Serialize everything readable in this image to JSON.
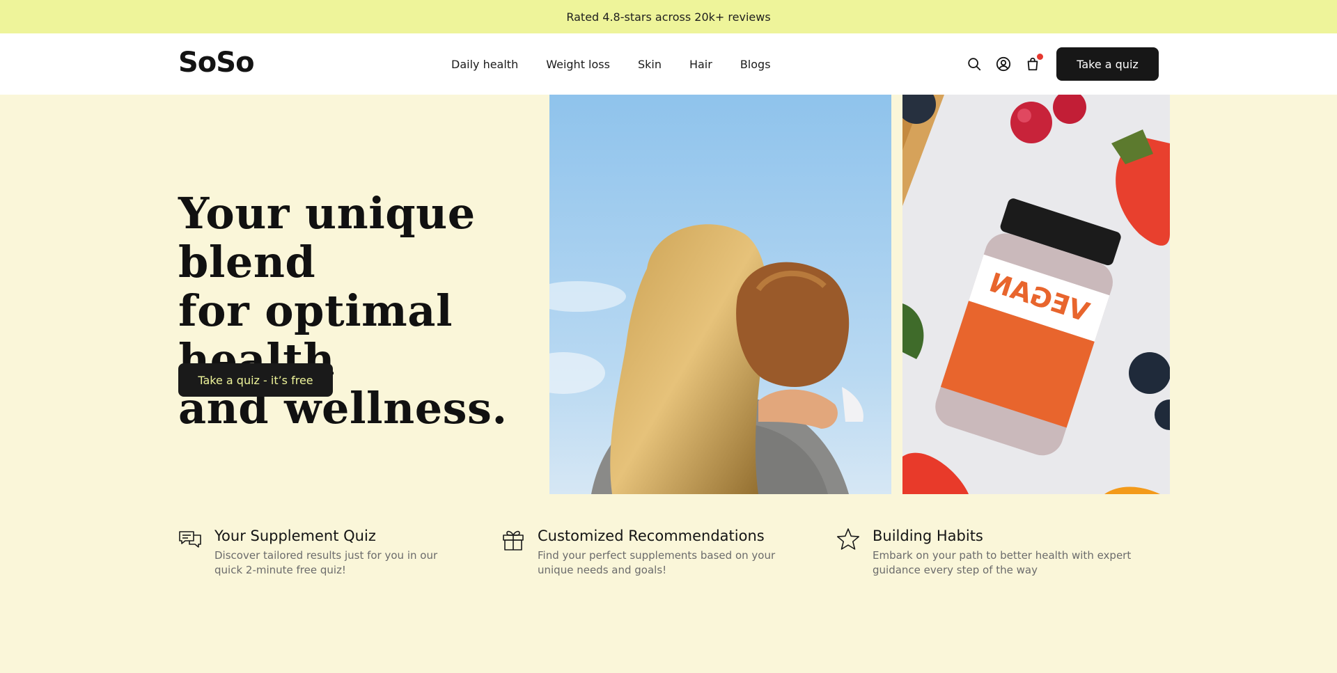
{
  "announcement": "Rated 4.8-stars across 20k+ reviews",
  "brand": "SoSo",
  "nav": {
    "items": [
      "Daily health",
      "Weight loss",
      "Skin",
      "Hair",
      "Blogs"
    ],
    "icons": [
      "search-icon",
      "account-icon",
      "cart-icon"
    ],
    "cta": "Take a quiz"
  },
  "hero": {
    "title_line1": "Your unique blend",
    "title_line2": "for optimal health",
    "title_line3": "and wellness.",
    "cta": "Take a quiz - it’s free",
    "bottle_label": "VEGAN"
  },
  "features": [
    {
      "icon": "chat-bubbles-icon",
      "title": "Your Supplement Quiz",
      "line1": "Discover tailored results just for you in our",
      "line2": "quick 2-minute free quiz!"
    },
    {
      "icon": "gift-icon",
      "title": "Customized Recommendations",
      "line1": "Find your perfect supplements based on your",
      "line2": "unique needs and goals!"
    },
    {
      "icon": "star-icon",
      "title": "Building Habits",
      "line1": "Embark on your path to better health with expert",
      "line2": "guidance every step of the way"
    }
  ],
  "colors": {
    "announcement_bg": "#eef49a",
    "page_bg": "#faf6d9",
    "button_bg": "#171717",
    "hero_cta_text": "#eef49a",
    "cart_badge": "#e5372f"
  }
}
